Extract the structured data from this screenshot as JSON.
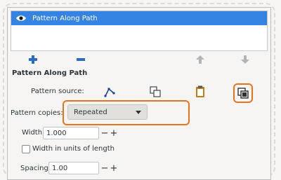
{
  "effects_list": {
    "items": [
      {
        "label": "Pattern Along Path",
        "visible": true,
        "selected": true
      }
    ]
  },
  "toolbar": {
    "add_icon": "plus-icon",
    "remove_icon": "minus-icon",
    "up_icon": "arrow-up-icon",
    "down_icon": "arrow-down-icon"
  },
  "effect": {
    "title": "Pattern Along Path",
    "pattern_source_label": "Pattern source:",
    "pattern_copies_label": "Pattern copies:",
    "pattern_copies_value": "Repeated",
    "width_label": "Width:",
    "width_value": "1.000",
    "width_units_label": "Width in units of length",
    "spacing_label": "Spacing:",
    "spacing_value": "1.00"
  },
  "colors": {
    "selection": "#3584e4",
    "highlight": "#e8731a"
  }
}
